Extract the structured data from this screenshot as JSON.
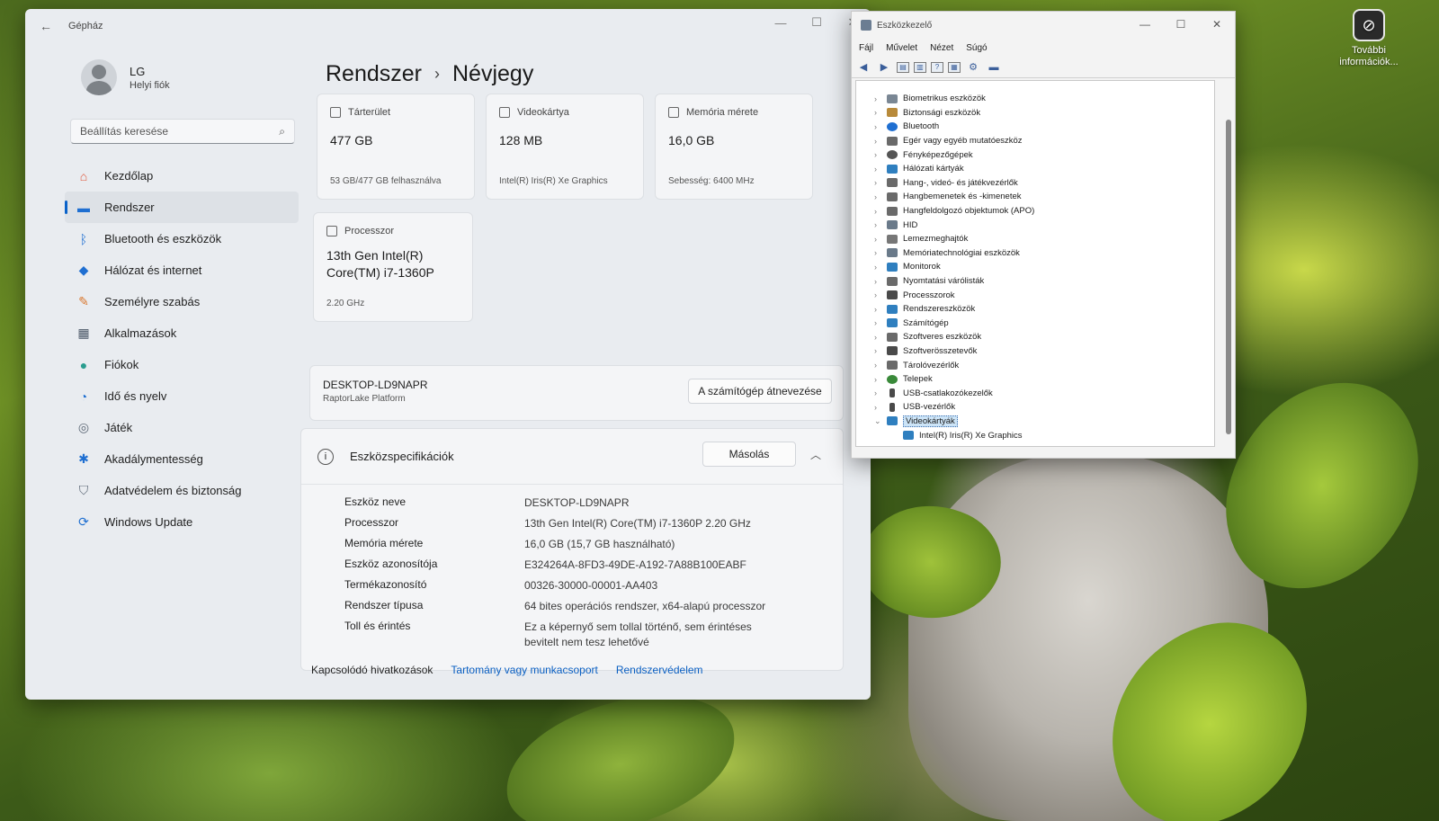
{
  "desktop": {
    "icon_label": "További információk..."
  },
  "settings": {
    "title": "Gépház",
    "profile": {
      "name": "LG",
      "type": "Helyi fiók"
    },
    "search_placeholder": "Beállítás keresése",
    "nav": [
      {
        "label": "Kezdőlap",
        "icon": "home-icon",
        "color": "#e0573a"
      },
      {
        "label": "Rendszer",
        "icon": "monitor-icon",
        "color": "#1f6fd1"
      },
      {
        "label": "Bluetooth és eszközök",
        "icon": "bluetooth-icon",
        "color": "#1f6fd1"
      },
      {
        "label": "Hálózat és internet",
        "icon": "wifi-icon",
        "color": "#1f6fd1"
      },
      {
        "label": "Személyre szabás",
        "icon": "brush-icon",
        "color": "#d9772e"
      },
      {
        "label": "Alkalmazások",
        "icon": "apps-icon",
        "color": "#4a5666"
      },
      {
        "label": "Fiókok",
        "icon": "account-icon",
        "color": "#2a9d8f"
      },
      {
        "label": "Idő és nyelv",
        "icon": "globe-clock-icon",
        "color": "#1f6fd1"
      },
      {
        "label": "Játék",
        "icon": "gamepad-icon",
        "color": "#5d6876"
      },
      {
        "label": "Akadálymentesség",
        "icon": "accessibility-icon",
        "color": "#1f6fd1"
      },
      {
        "label": "Adatvédelem és biztonság",
        "icon": "shield-icon",
        "color": "#5d6876"
      },
      {
        "label": "Windows Update",
        "icon": "update-icon",
        "color": "#1f6fd1"
      }
    ],
    "breadcrumb": {
      "parent": "Rendszer",
      "sep": "›",
      "current": "Névjegy"
    },
    "cards": {
      "storage": {
        "head": "Tárterület",
        "value": "477 GB",
        "foot": "53 GB/477 GB felhasználva"
      },
      "gpu": {
        "head": "Videokártya",
        "value": "128 MB",
        "foot": "Intel(R) Iris(R) Xe Graphics"
      },
      "memory": {
        "head": "Memória mérete",
        "value": "16,0 GB",
        "foot": "Sebesség: 6400 MHz"
      },
      "cpu": {
        "head": "Processzor",
        "value": "13th Gen Intel(R) Core(TM) i7-1360P",
        "foot": "2.20 GHz"
      }
    },
    "device": {
      "name": "DESKTOP-LD9NAPR",
      "platform": "RaptorLake Platform",
      "rename_button": "A számítógép átnevezése"
    },
    "spec": {
      "title": "Eszközspecifikációk",
      "copy_button": "Másolás",
      "rows": [
        {
          "k": "Eszköz neve",
          "v": "DESKTOP-LD9NAPR"
        },
        {
          "k": "Processzor",
          "v": "13th Gen Intel(R) Core(TM) i7-1360P   2.20 GHz"
        },
        {
          "k": "Memória mérete",
          "v": "16,0 GB (15,7 GB használható)"
        },
        {
          "k": "Eszköz azonosítója",
          "v": "E324264A-8FD3-49DE-A192-7A88B100EABF"
        },
        {
          "k": "Termékazonosító",
          "v": "00326-30000-00001-AA403"
        },
        {
          "k": "Rendszer típusa",
          "v": "64 bites operációs rendszer, x64-alapú processzor"
        },
        {
          "k": "Toll és érintés",
          "v": "Ez a képernyő sem tollal történő, sem érintéses bevitelt nem tesz lehetővé"
        }
      ]
    },
    "related": {
      "label": "Kapcsolódó hivatkozások",
      "link1": "Tartomány vagy munkacsoport",
      "link2": "Rendszervédelem"
    }
  },
  "devmgr": {
    "title": "Eszközkezelő",
    "menu": [
      "Fájl",
      "Művelet",
      "Nézet",
      "Súgó"
    ],
    "tree": [
      {
        "label": "Biometrikus eszközök",
        "color": "#7a8794"
      },
      {
        "label": "Biztonsági eszközök",
        "color": "#b88a3a"
      },
      {
        "label": "Bluetooth",
        "color": "#1f6fd1"
      },
      {
        "label": "Egér vagy egyéb mutatóeszköz",
        "color": "#6a6a6a"
      },
      {
        "label": "Fényképezőgépek",
        "color": "#555555"
      },
      {
        "label": "Hálózati kártyák",
        "color": "#2f7fbf"
      },
      {
        "label": "Hang-, videó- és játékvezérlők",
        "color": "#6a6a6a"
      },
      {
        "label": "Hangbemenetek és -kimenetek",
        "color": "#6a6a6a"
      },
      {
        "label": "Hangfeldolgozó objektumok (APO)",
        "color": "#6a6a6a"
      },
      {
        "label": "HID",
        "color": "#6a7a8a"
      },
      {
        "label": "Lemezmeghajtók",
        "color": "#777777"
      },
      {
        "label": "Memóriatechnológiai eszközök",
        "color": "#6a7a8a"
      },
      {
        "label": "Monitorok",
        "color": "#2f7fbf"
      },
      {
        "label": "Nyomtatási várólisták",
        "color": "#6a6a6a"
      },
      {
        "label": "Processzorok",
        "color": "#4a4a4a"
      },
      {
        "label": "Rendszereszközök",
        "color": "#2f7fbf"
      },
      {
        "label": "Számítógép",
        "color": "#2f7fbf"
      },
      {
        "label": "Szoftveres eszközök",
        "color": "#6a6a6a"
      },
      {
        "label": "Szoftverösszetevők",
        "color": "#4a4a4a"
      },
      {
        "label": "Tárolóvezérlők",
        "color": "#6a6a6a"
      },
      {
        "label": "Telepek",
        "color": "#3a8a3a"
      },
      {
        "label": "USB-csatlakozókezelők",
        "color": "#4a4a4a"
      },
      {
        "label": "USB-vezérlők",
        "color": "#4a4a4a"
      }
    ],
    "expanded": {
      "label": "Videokártyák",
      "child": "Intel(R) Iris(R) Xe Graphics"
    }
  }
}
